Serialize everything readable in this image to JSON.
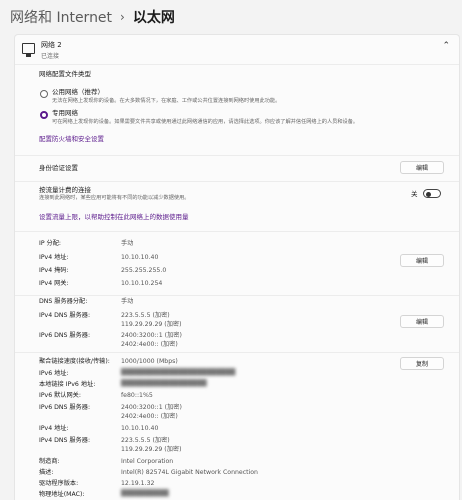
{
  "header": {
    "parent": "网络和 Internet",
    "separator": "›",
    "current": "以太网"
  },
  "network": {
    "name": "网络 2",
    "status": "已连接"
  },
  "profile": {
    "section_title": "网络配置文件类型",
    "public_label": "公用网络（推荐）",
    "public_desc": "无法在网络上发现你的设备。在大多数情况下，在家庭、工作或公共位置连接到网络时使用此功能。",
    "private_label": "专用网络",
    "private_desc": "可在网络上发现你的设备。如果需要文件共享或使用通过此网络通信的应用，请选择此选项。你应该了解并信任网络上的人员和设备。",
    "selected": "private",
    "firewall_link": "配置防火墙和安全设置"
  },
  "auth": {
    "label": "身份验证设置",
    "button": "编辑"
  },
  "metered": {
    "label": "按流量计费的连接",
    "desc": "连接到此网络时，某些应用可能将有不同的功能以减少数据使用。",
    "state": "关",
    "link": "设置流量上限，以帮助控制在此网络上的数据使用量"
  },
  "ip": {
    "rows": [
      {
        "k": "IP 分配:",
        "v": "手动"
      },
      {
        "k": "IPv4 地址:",
        "v": "10.10.10.40"
      },
      {
        "k": "IPv4 掩码:",
        "v": "255.255.255.0"
      },
      {
        "k": "IPv4 网关:",
        "v": "10.10.10.254"
      }
    ],
    "button": "编辑"
  },
  "dns": {
    "assign_k": "DNS 服务器分配:",
    "assign_v": "手动",
    "v4_k": "IPv4 DNS 服务器:",
    "v4_1": "223.5.5.5 (加密)",
    "v4_2": "119.29.29.29 (加密)",
    "v6_k": "IPv6 DNS 服务器:",
    "v6_1": "2400:3200::1 (加密)",
    "v6_2": "2402:4e00:: (加密)",
    "button": "编辑"
  },
  "props": {
    "copy_button": "复制",
    "speed_k": "聚合链接速度(接收/传输):",
    "speed_v": "1000/1000 (Mbps)",
    "ipv6_k": "IPv6 地址:",
    "ipv6_v": "",
    "lla_k": "本地链接 IPv6 地址:",
    "lla_v": "",
    "gw6_k": "IPv6 默认网关:",
    "gw6_v": "fe80::1%5",
    "dns6_k": "IPv6 DNS 服务器:",
    "dns6_1": "2400:3200::1 (加密)",
    "dns6_2": "2402:4e00:: (加密)",
    "v4_k": "IPv4 地址:",
    "v4_v": "10.10.10.40",
    "dns4_k": "IPv4 DNS 服务器:",
    "dns4_1": "223.5.5.5 (加密)",
    "dns4_2": "119.29.29.29 (加密)",
    "mfr_k": "制造商:",
    "mfr_v": "Intel Corporation",
    "desc_k": "描述:",
    "desc_v": "Intel(R) 82574L Gigabit Network Connection",
    "drv_k": "驱动程序版本:",
    "drv_v": "12.19.1.32",
    "mac_k": "物理地址(MAC):",
    "mac_v": ""
  }
}
